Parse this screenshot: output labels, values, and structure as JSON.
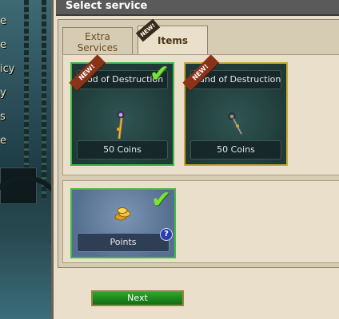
{
  "window": {
    "title": "Select service"
  },
  "tabs": [
    {
      "label": "Extra Services",
      "new": false
    },
    {
      "label": "Items",
      "new": true,
      "new_badge": "NEW!"
    }
  ],
  "background_menu": [
    "e",
    "e",
    "icy",
    "y",
    "s",
    "e"
  ],
  "items": [
    {
      "name": "Rod of Destruction",
      "price": "50 Coins",
      "new_badge": "NEW!",
      "selected": true,
      "border_color": "#44b844"
    },
    {
      "name": "Wand of Destruction",
      "price": "50 Coins",
      "new_badge": "NEW!",
      "selected": false,
      "border_color": "#c9a832"
    }
  ],
  "points_offer": {
    "label": "Points",
    "help": "?",
    "selected": true
  },
  "next_button": {
    "label": "Next"
  },
  "colors": {
    "accent_green": "#44b844",
    "selected_check": "#7be23b",
    "frame_bg": "#e9dfcb"
  }
}
